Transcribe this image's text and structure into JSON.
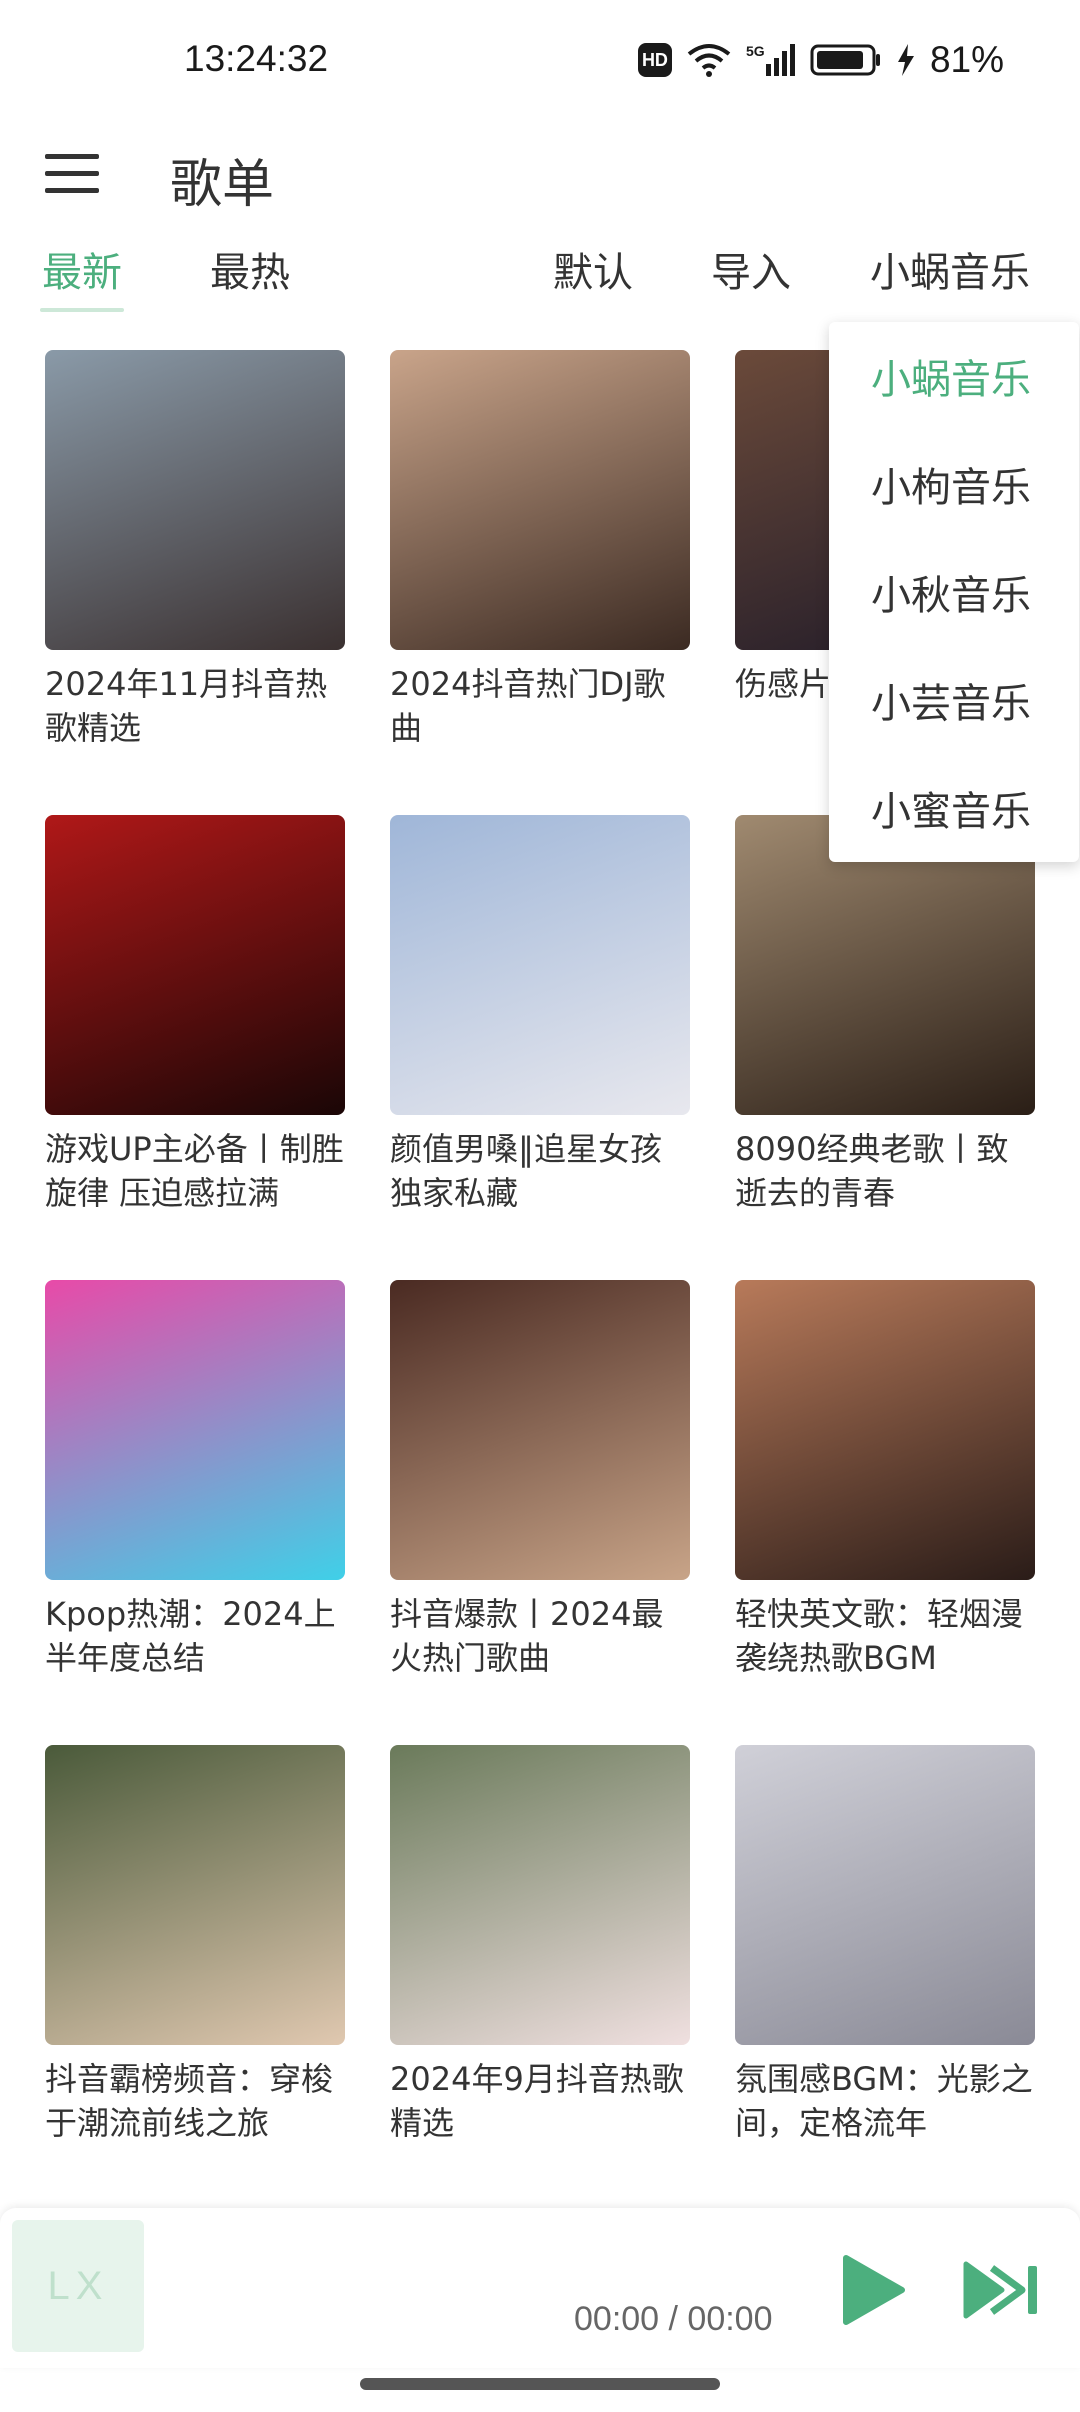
{
  "status_bar": {
    "time": "13:24:32",
    "hd": "HD",
    "network": "5G",
    "battery": "81%",
    "icons": [
      "hd-icon",
      "wifi-icon",
      "signal-icon",
      "battery-icon",
      "charging-icon"
    ]
  },
  "header": {
    "title": "歌单",
    "menu_icon": "hamburger-menu-icon"
  },
  "tabs": {
    "latest": "最新",
    "hottest": "最热",
    "default": "默认",
    "import": "导入",
    "source": "小蜗音乐"
  },
  "dropdown": {
    "items": [
      {
        "label": "小蜗音乐",
        "active": true
      },
      {
        "label": "小枸音乐",
        "active": false
      },
      {
        "label": "小秋音乐",
        "active": false
      },
      {
        "label": "小芸音乐",
        "active": false
      },
      {
        "label": "小蜜音乐",
        "active": false
      }
    ]
  },
  "playlists": [
    {
      "title": "2024年11月抖音热歌精选",
      "color_a": "#8a9aa8",
      "color_b": "#3a3030"
    },
    {
      "title": "2024抖音热门DJ歌曲",
      "color_a": "#c9a48a",
      "color_b": "#3b2a22"
    },
    {
      "title": "伤感片段旋律，回味",
      "color_a": "#6b4a3a",
      "color_b": "#1f1a28"
    },
    {
      "title": "游戏UP主必备丨制胜旋律 压迫感拉满",
      "color_a": "#b01818",
      "color_b": "#1a0606"
    },
    {
      "title": "颜值男嗓‖追星女孩独家私藏",
      "color_a": "#9fb6d8",
      "color_b": "#e8e8ee"
    },
    {
      "title": "8090经典老歌丨致逝去的青春",
      "color_a": "#a08a70",
      "color_b": "#2a1e16"
    },
    {
      "title": "Kpop热潮：2024上半年度总结",
      "color_a": "#e84aa8",
      "color_b": "#3fd0e8"
    },
    {
      "title": "抖音爆款丨2024最火热门歌曲",
      "color_a": "#4a2a22",
      "color_b": "#c8a488"
    },
    {
      "title": "轻快英文歌：轻烟漫袭绕热歌BGM",
      "color_a": "#b87a5a",
      "color_b": "#2a1c18"
    },
    {
      "title": "抖音霸榜频音：穿梭于潮流前线之旅",
      "color_a": "#4a5a3a",
      "color_b": "#e0c8b0"
    },
    {
      "title": "2024年9月抖音热歌精选",
      "color_a": "#6a7a5a",
      "color_b": "#f0e0e0"
    },
    {
      "title": "氛围感BGM：光影之间，定格流年",
      "color_a": "#d0d0d8",
      "color_b": "#8a8a96"
    }
  ],
  "player": {
    "placeholder": "LX",
    "time": "00:00 / 00:00",
    "play_icon": "play-icon",
    "next_icon": "skip-next-icon"
  },
  "colors": {
    "accent": "#4caf7e",
    "text": "#333333"
  }
}
